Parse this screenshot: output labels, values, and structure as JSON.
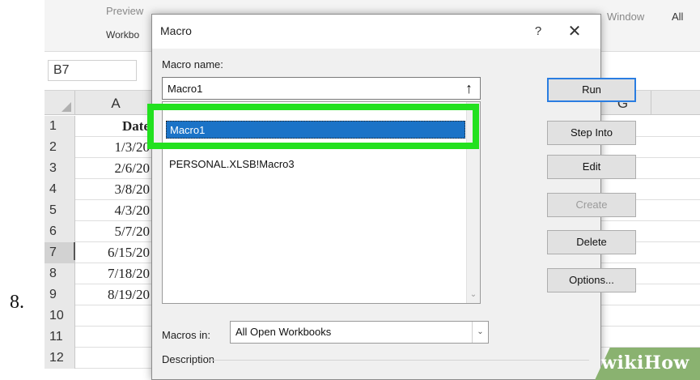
{
  "step": {
    "number": "8."
  },
  "ribbon": {
    "preview": "Preview",
    "workbook": "Workbo",
    "window": "Window",
    "all": "All"
  },
  "formula_bar": {
    "name_box": "B7"
  },
  "grid": {
    "columns": [
      "A",
      "G"
    ],
    "rows": [
      {
        "num": "1",
        "a": "Date",
        "header": true
      },
      {
        "num": "2",
        "a": "1/3/20"
      },
      {
        "num": "3",
        "a": "2/6/20"
      },
      {
        "num": "4",
        "a": "3/8/20"
      },
      {
        "num": "5",
        "a": "4/3/20"
      },
      {
        "num": "6",
        "a": "5/7/20"
      },
      {
        "num": "7",
        "a": "6/15/20",
        "selected": true
      },
      {
        "num": "8",
        "a": "7/18/20"
      },
      {
        "num": "9",
        "a": "8/19/20"
      },
      {
        "num": "10",
        "a": ""
      },
      {
        "num": "11",
        "a": ""
      },
      {
        "num": "12",
        "a": ""
      }
    ]
  },
  "dialog": {
    "title": "Macro",
    "help": "?",
    "close": "✕",
    "macro_name_label": "Macro name:",
    "macro_name_value": "Macro1",
    "upload_icon": "↑",
    "macros": [
      {
        "name": "Macro1",
        "selected": true
      },
      {
        "name": "PERSONAL.XLSB!Macro3",
        "selected": false
      }
    ],
    "buttons": [
      {
        "id": "run",
        "label": "Run",
        "enabled": true,
        "default": true
      },
      {
        "id": "step-into",
        "label": "Step Into",
        "enabled": true
      },
      {
        "id": "edit",
        "label": "Edit",
        "enabled": true
      },
      {
        "id": "create",
        "label": "Create",
        "enabled": false
      },
      {
        "id": "delete",
        "label": "Delete",
        "enabled": true
      },
      {
        "id": "options",
        "label": "Options...",
        "enabled": true
      }
    ],
    "macros_in_label": "Macros in:",
    "macros_in_value": "All Open Workbooks",
    "description_label": "Description"
  },
  "watermark": {
    "wiki": "wiki",
    "how": "How"
  },
  "colors": {
    "highlight": "#22e11f",
    "selection": "#1b73c7",
    "watermark_bg": "#8ab270"
  }
}
